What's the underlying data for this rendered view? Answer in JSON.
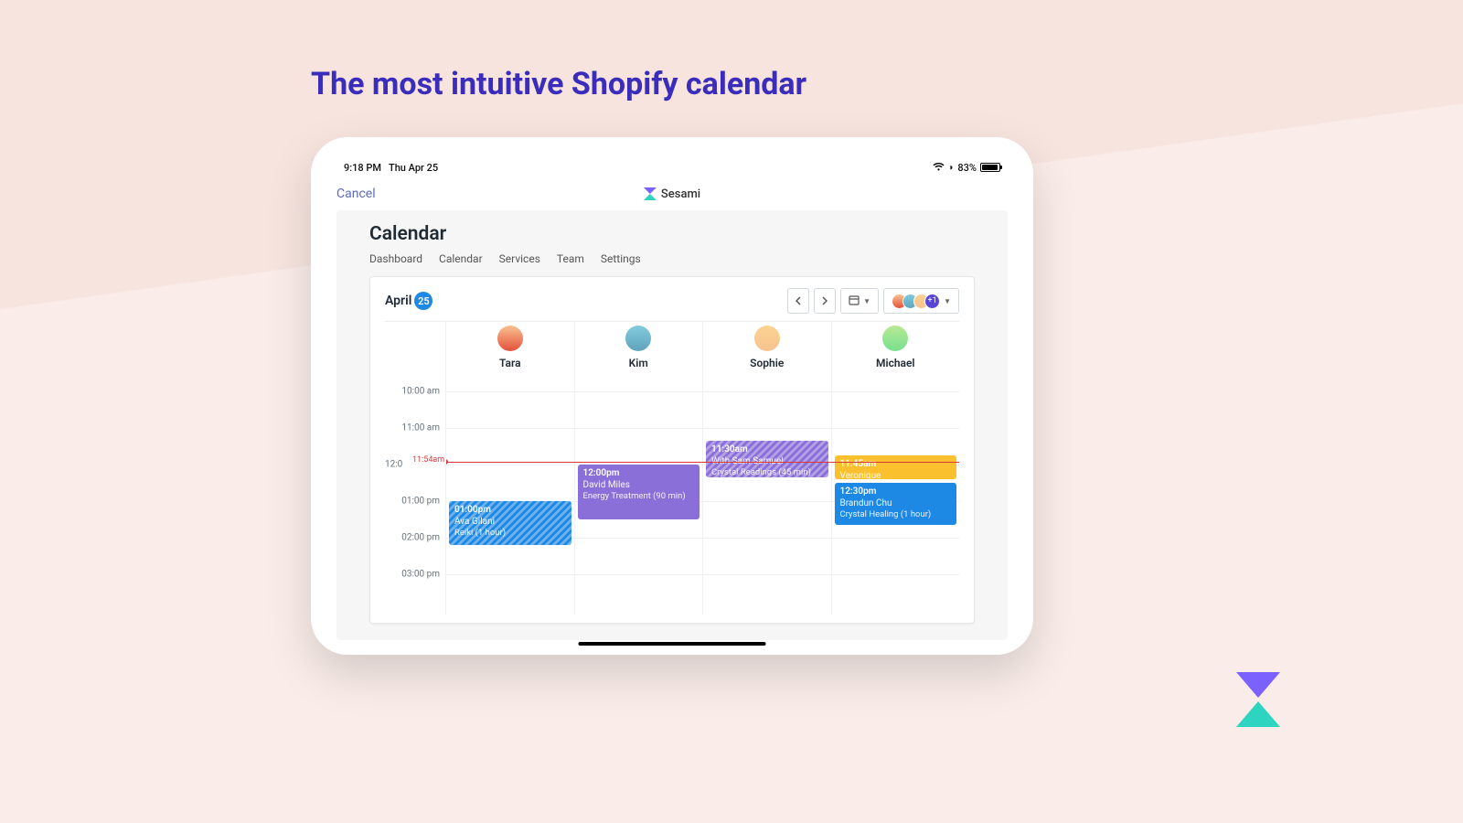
{
  "page": {
    "headline": "The most intuitive Shopify calendar"
  },
  "statusbar": {
    "time": "9:18 PM",
    "date": "Thu Apr 25",
    "battery": "83%"
  },
  "nav": {
    "cancel": "Cancel",
    "brand": "Sesami"
  },
  "header": {
    "title": "Calendar",
    "tabs": [
      "Dashboard",
      "Calendar",
      "Services",
      "Team",
      "Settings"
    ]
  },
  "calendar": {
    "month": "April",
    "day": "25",
    "now_label": "11:54am",
    "now_label_prefix": "12:0",
    "people": [
      "Tara",
      "Kim",
      "Sophie",
      "Michael"
    ],
    "times": [
      "10:00 am",
      "11:00 am",
      "",
      "01:00 pm",
      "02:00 pm",
      "03:00 pm"
    ],
    "team_filter_overflow": "+1",
    "events": {
      "tara": {
        "time": "01:00pm",
        "name": "Ava Gilani",
        "detail": "Reiki (1 hour)"
      },
      "kim": {
        "time": "12:00pm",
        "name": "David Miles",
        "detail": "Energy Treatment (90 min)"
      },
      "sophie": {
        "time": "11:30am",
        "name": "With Sam Samuel",
        "detail": "Crystal Readings (45 min)"
      },
      "michael_a": {
        "time": "11:45am",
        "name": "Veronique",
        "detail": ""
      },
      "michael_b": {
        "time": "12:30pm",
        "name": "Brandun Chu",
        "detail": "Crystal Healing (1 hour)"
      }
    }
  }
}
